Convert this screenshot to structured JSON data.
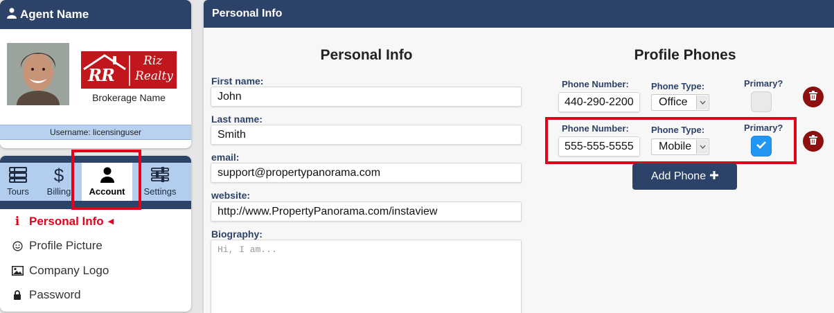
{
  "agent": {
    "header": "Agent Name",
    "brokerage_name": "Brokerage Name",
    "logo_initials": "RR",
    "logo_text_line1": "Riz",
    "logo_text_line2": "Realty",
    "username_line": "Username: licensinguser"
  },
  "nav": {
    "tabs": [
      {
        "label": "Tours",
        "icon": "list-icon"
      },
      {
        "label": "Billing",
        "icon": "dollar-icon"
      },
      {
        "label": "Account",
        "icon": "user-icon",
        "active": true
      },
      {
        "label": "Settings",
        "icon": "sliders-icon"
      }
    ]
  },
  "menu": {
    "items": [
      {
        "label": "Personal Info",
        "icon": "info-icon",
        "active": true
      },
      {
        "label": "Profile Picture",
        "icon": "smile-icon"
      },
      {
        "label": "Company Logo",
        "icon": "image-icon"
      },
      {
        "label": "Password",
        "icon": "lock-icon"
      }
    ]
  },
  "main": {
    "header": "Personal Info",
    "personal_title": "Personal Info",
    "phones_title": "Profile Phones"
  },
  "form": {
    "first_name": {
      "label": "First name:",
      "value": "John"
    },
    "last_name": {
      "label": "Last name:",
      "value": "Smith"
    },
    "email": {
      "label": "email:",
      "value": "support@propertypanorama.com"
    },
    "website": {
      "label": "website:",
      "value": "http://www.PropertyPanorama.com/instaview"
    },
    "biography": {
      "label": "Biography:",
      "placeholder": "Hi, I am..."
    }
  },
  "phones": {
    "number_label": "Phone Number:",
    "type_label": "Phone Type:",
    "primary_label": "Primary?",
    "rows": [
      {
        "number": "440-290-2200",
        "type": "Office",
        "primary": false
      },
      {
        "number": "555-555-5555",
        "type": "Mobile",
        "primary": true
      }
    ],
    "add_button": "Add Phone"
  },
  "colors": {
    "navy": "#2c4268",
    "accent_red": "#e4001b",
    "check_blue": "#2196f3",
    "delete_red": "#8e0f10"
  }
}
